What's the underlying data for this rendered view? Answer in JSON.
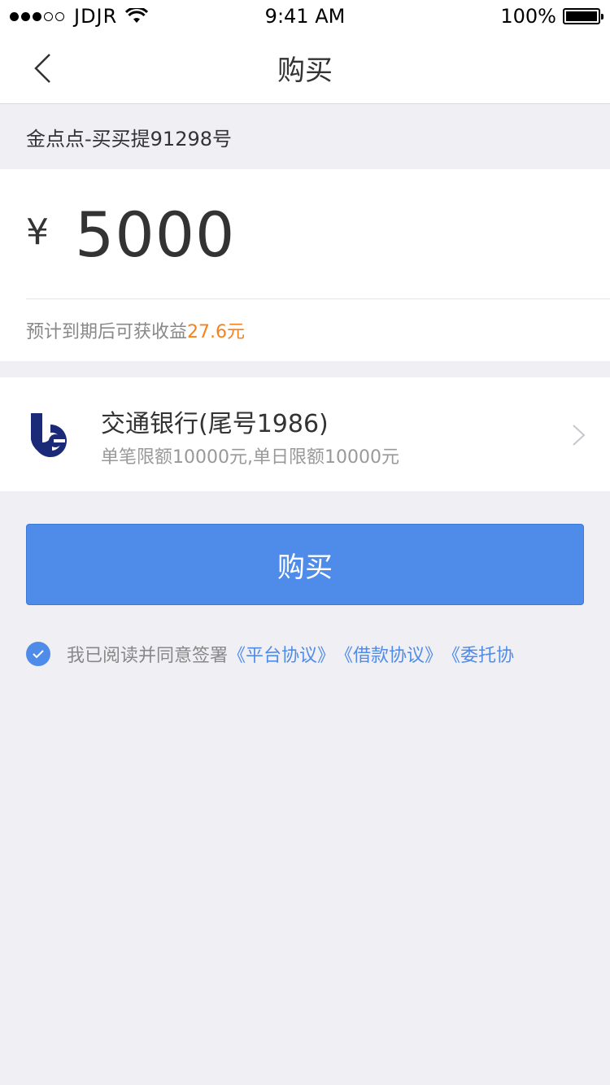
{
  "status_bar": {
    "carrier": "JDJR",
    "time": "9:41 AM",
    "battery": "100%"
  },
  "nav": {
    "title": "购买"
  },
  "product": {
    "name": "金点点-买买提91298号"
  },
  "amount": {
    "currency_symbol": "¥",
    "value": "5000",
    "earn_prefix": "预计到期后可获收益",
    "earn_amount": "27.6元"
  },
  "bank": {
    "name": "交通银行(尾号1986)",
    "limit": "单笔限额10000元,单日限额10000元"
  },
  "buy_button": {
    "label": "购买"
  },
  "agreement": {
    "prefix": "我已阅读并同意签署",
    "links": [
      "《平台协议》",
      "《借款协议》",
      "《委托协"
    ]
  },
  "colors": {
    "accent": "#4f8cea",
    "earn": "#f5821f",
    "background": "#efeff4"
  }
}
